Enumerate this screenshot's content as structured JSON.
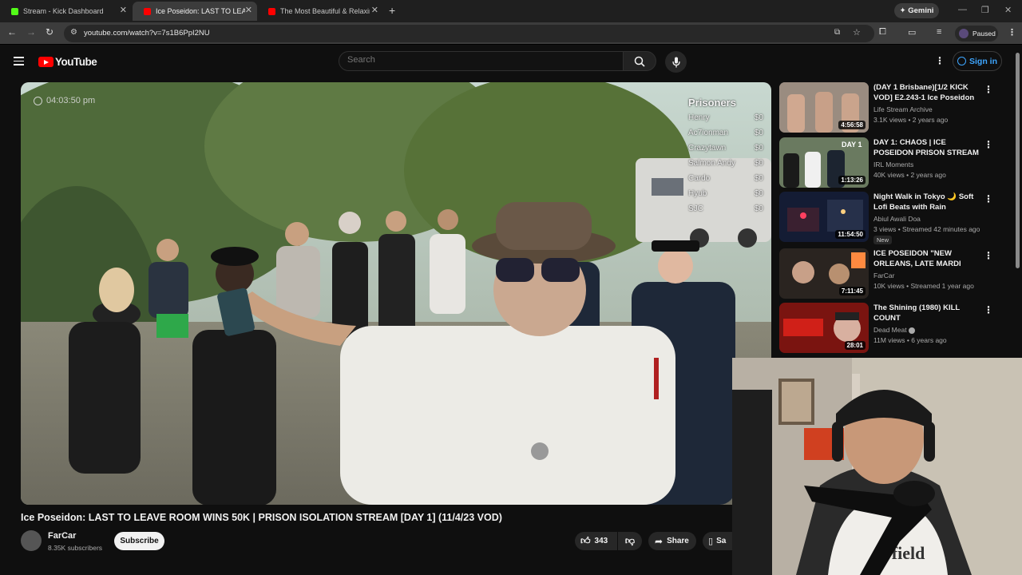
{
  "browser": {
    "tabs": [
      {
        "title": "Stream - Kick Dashboard",
        "favicon_color": "#53fc18",
        "active": false
      },
      {
        "title": "Ice Poseidon: LAST TO LEAVE RO",
        "favicon_color": "#ff0000",
        "active": true
      },
      {
        "title": "The Most Beautiful & Relaxing",
        "favicon_color": "#ff0000",
        "active": false
      }
    ],
    "new_tab_label": "+",
    "gemini_label": "Gemini",
    "url": "youtube.com/watch?v=7s1B6PpI2NU",
    "profile_label": "Paused"
  },
  "youtube": {
    "logo_text": "YouTube",
    "search_placeholder": "Search",
    "sign_in_label": "Sign in"
  },
  "video": {
    "overlay_time": "04:03:50 pm",
    "prisoners_title": "Prisoners",
    "prisoners": [
      {
        "name": "Henry",
        "amount": "$0"
      },
      {
        "name": "Ac7ionman",
        "amount": "$0"
      },
      {
        "name": "Crazytawn",
        "amount": "$0"
      },
      {
        "name": "Salmon Andy",
        "amount": "$0"
      },
      {
        "name": "Cardo",
        "amount": "$0"
      },
      {
        "name": "Hyub",
        "amount": "$0"
      },
      {
        "name": "SJC",
        "amount": "$0"
      }
    ],
    "title": "Ice Poseidon: LAST TO LEAVE ROOM WINS 50K | PRISON ISOLATION STREAM [DAY 1] (11/4/23 VOD)",
    "channel": "FarCar",
    "subscribers": "8.35K subscribers",
    "subscribe_label": "Subscribe",
    "likes": "343",
    "share_label": "Share",
    "save_label": "Sa"
  },
  "recommendations": [
    {
      "title": "(DAY 1 Brisbane)[1/2 KICK VOD] E2.243-1 Ice Poseidon ...",
      "channel": "Life Stream Archive",
      "meta": "3.1K views • 2 years ago",
      "duration": "4:56:58",
      "badge": "",
      "color": "#8a7a70"
    },
    {
      "title": "DAY 1: CHAOS | ICE POSEIDON PRISON STREAM (FULL RECAP)",
      "channel": "IRL Moments",
      "meta": "40K views • 2 years ago",
      "duration": "1:13:26",
      "badge": "",
      "color": "#5d6a58"
    },
    {
      "title": "Night Walk in Tokyo 🌙 Soft Lofi Beats with Rain Ambience...",
      "channel": "Abiul Awali Doa",
      "meta": "3 views • Streamed 42 minutes ago",
      "duration": "11:54:50",
      "badge": "New",
      "color": "#1e2a4a"
    },
    {
      "title": "ICE POSEIDON \"NEW ORLEANS, LATE MARDI GRAS\" KICK VOD...",
      "channel": "FarCar",
      "meta": "10K views • Streamed 1 year ago",
      "duration": "7:11:45",
      "badge": "",
      "color": "#3a3430"
    },
    {
      "title": "The Shining (1980) KILL COUNT",
      "channel": "Dead Meat",
      "meta": "11M views • 6 years ago",
      "duration": "28:01",
      "badge": "",
      "color": "#8a1a14"
    }
  ],
  "webcam_shirt_text": "rfield"
}
